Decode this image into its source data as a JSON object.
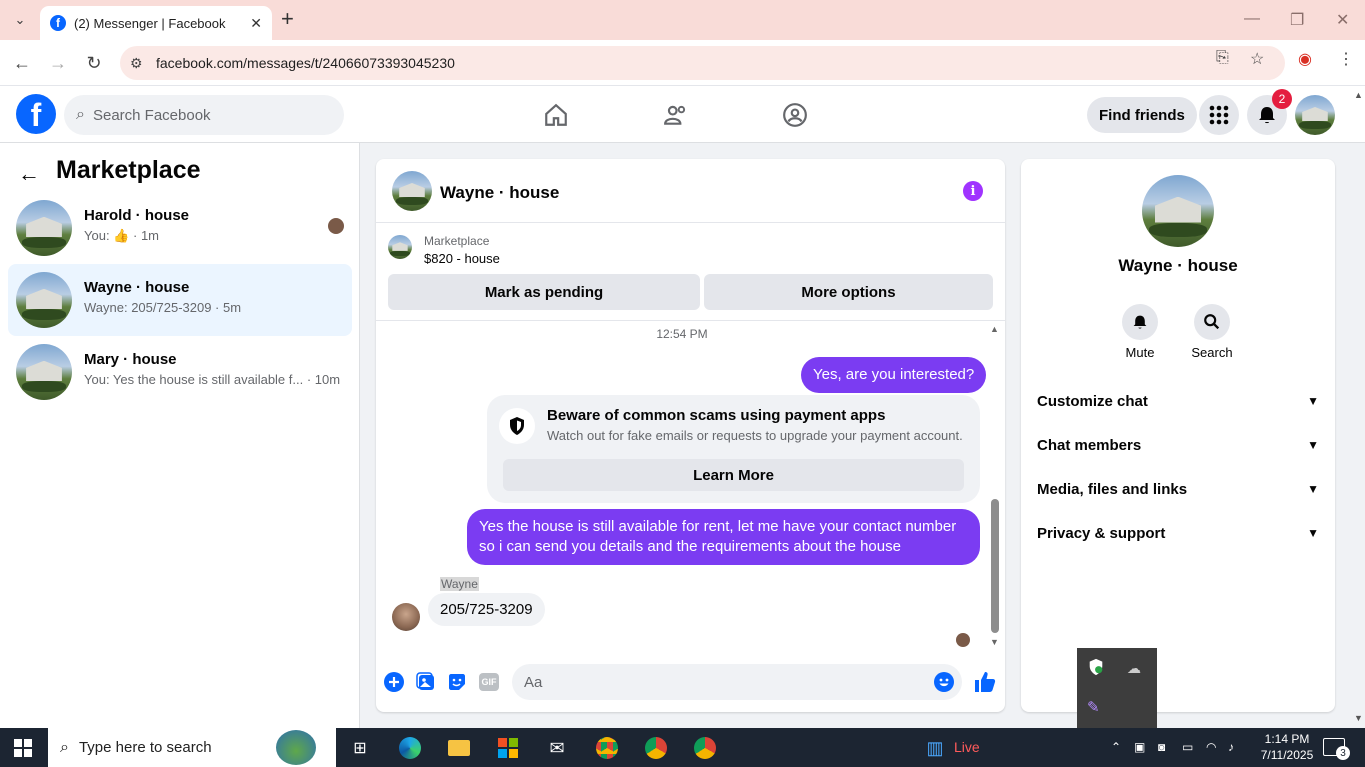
{
  "browser": {
    "tab_title": "(2) Messenger | Facebook",
    "url": "facebook.com/messages/t/24066073393045230"
  },
  "fb_header": {
    "search_placeholder": "Search Facebook",
    "find_friends": "Find friends",
    "notification_count": "2"
  },
  "left_panel": {
    "title": "Marketplace",
    "conversations": [
      {
        "name": "Harold · house",
        "snippet_prefix": "You:",
        "snippet_time": "· 1m"
      },
      {
        "name": "Wayne · house",
        "snippet": "Wayne: 205/725-3209 · 5m"
      },
      {
        "name": "Mary · house",
        "snippet": "You: Yes the house is still available f...",
        "time": "· 10m"
      }
    ]
  },
  "chat": {
    "name": "Wayne · house",
    "marketplace_label": "Marketplace",
    "listing": "$820 - house",
    "mark_pending": "Mark as pending",
    "more_options": "More options",
    "timestamp": "12:54 PM",
    "msg1": "Yes, are you interested?",
    "scam_title": "Beware of common scams using payment apps",
    "scam_desc": "Watch out for fake emails or requests to upgrade your payment account.",
    "learn_more": "Learn More",
    "msg2_line1": "Yes the house is still available for rent, let me have your contact number",
    "msg2_line2": "so i can send you details and the requirements about the house",
    "sender": "Wayne",
    "incoming": "205/725-3209",
    "composer_placeholder": "Aa",
    "gif": "GIF"
  },
  "right_panel": {
    "name": "Wayne · house",
    "mute": "Mute",
    "search": "Search",
    "sections": [
      "Customize chat",
      "Chat members",
      "Media, files and links",
      "Privacy & support"
    ]
  },
  "taskbar": {
    "search_placeholder": "Type here to search",
    "live": "Live",
    "time": "1:14 PM",
    "date": "7/11/2025",
    "notif_count": "3"
  }
}
